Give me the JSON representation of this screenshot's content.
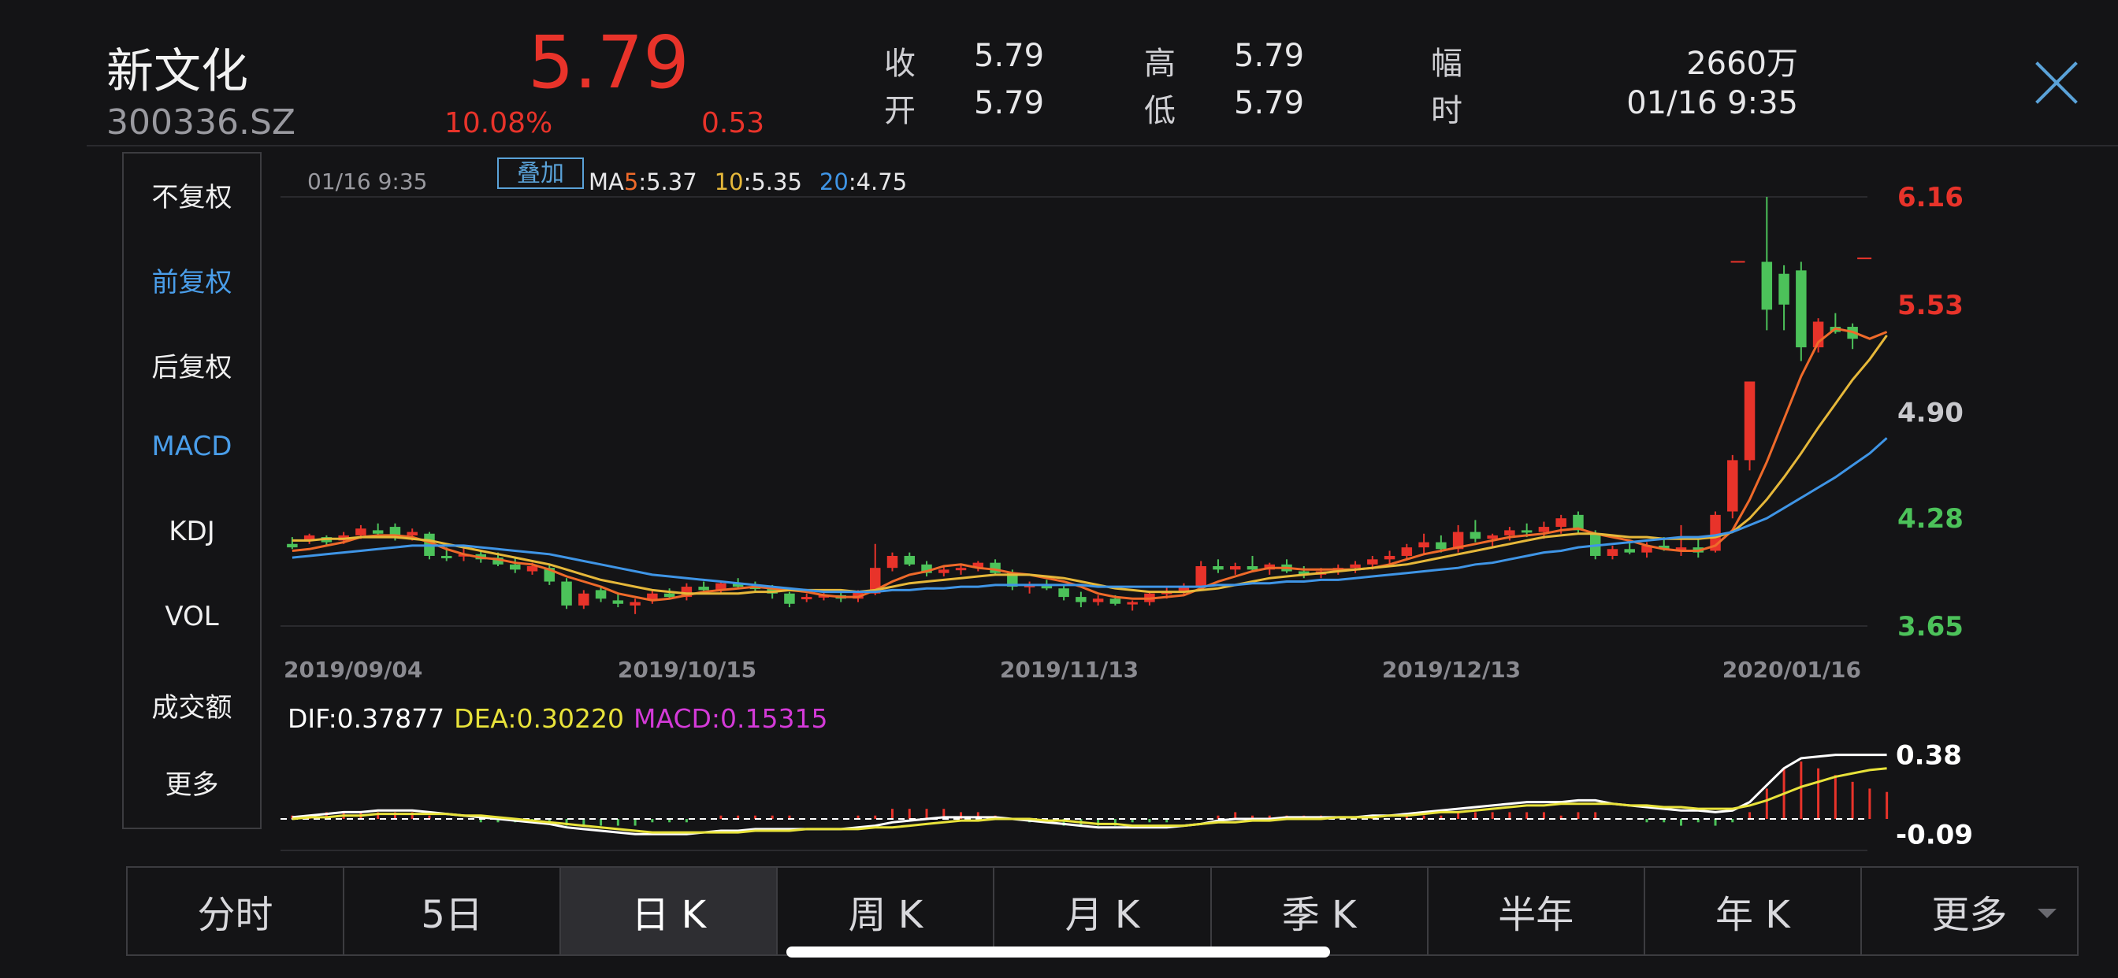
{
  "header": {
    "name": "新文化",
    "code": "300336.SZ",
    "price": "5.79",
    "change_pct": "10.08%",
    "change_amt": "0.53",
    "quote": {
      "close_label": "收",
      "close_value": "5.79",
      "open_label": "开",
      "open_value": "5.79",
      "high_label": "高",
      "high_value": "5.79",
      "low_label": "低",
      "low_value": "5.79",
      "amp_label": "幅",
      "amp_value": "2660万",
      "time_label": "时",
      "time_value": "01/16 9:35"
    }
  },
  "sidebar": {
    "items": [
      {
        "label": "不复权",
        "active": false
      },
      {
        "label": "前复权",
        "active": true
      },
      {
        "label": "后复权",
        "active": false
      },
      {
        "label": "MACD",
        "active": true
      },
      {
        "label": "KDJ",
        "active": false
      },
      {
        "label": "VOL",
        "active": false
      },
      {
        "label": "成交额",
        "active": false
      },
      {
        "label": "更多",
        "active": false
      }
    ]
  },
  "chart_info": {
    "time": "01/16 9:35",
    "overlay_label": "叠加",
    "ma_prefix": "MA",
    "ma5_label": "5",
    "ma5_value": ":5.37",
    "ma10_label": "10",
    "ma10_value": ":5.35",
    "ma20_label": "20",
    "ma20_value": ":4.75"
  },
  "indicator": {
    "dif": "DIF:0.37877",
    "dea": "DEA:0.30220",
    "macd": "MACD:0.15315"
  },
  "tabs": [
    {
      "label": "分时",
      "active": false
    },
    {
      "label": "5日",
      "active": false
    },
    {
      "label": "日 K",
      "active": true
    },
    {
      "label": "周 K",
      "active": false
    },
    {
      "label": "月 K",
      "active": false
    },
    {
      "label": "季 K",
      "active": false
    },
    {
      "label": "半年",
      "active": false
    },
    {
      "label": "年 K",
      "active": false
    },
    {
      "label": "更多",
      "active": false
    }
  ],
  "colors": {
    "up": "#e8332a",
    "down": "#4cc25a",
    "ma5": "#ef6a2a",
    "ma10": "#e6b83a",
    "ma20": "#3f95e6",
    "dif": "#ffffff",
    "dea": "#e8e23a",
    "macd": "#d43ad8",
    "accent": "#4a9eea"
  },
  "chart_data": {
    "type": "candlestick",
    "x_labels": [
      "2019/09/04",
      "2019/10/15",
      "2019/11/13",
      "2019/12/13",
      "2020/01/16"
    ],
    "y_labels": [
      "6.16",
      "5.53",
      "4.90",
      "4.28",
      "3.65"
    ],
    "ylim": [
      3.65,
      6.16
    ],
    "candles": [
      [
        4.13,
        4.17,
        4.1,
        4.11
      ],
      [
        4.15,
        4.19,
        4.13,
        4.18
      ],
      [
        4.17,
        4.18,
        4.12,
        4.14
      ],
      [
        4.15,
        4.2,
        4.13,
        4.18
      ],
      [
        4.18,
        4.24,
        4.16,
        4.22
      ],
      [
        4.21,
        4.25,
        4.17,
        4.19
      ],
      [
        4.23,
        4.25,
        4.15,
        4.17
      ],
      [
        4.18,
        4.22,
        4.15,
        4.2
      ],
      [
        4.19,
        4.2,
        4.04,
        4.06
      ],
      [
        4.06,
        4.11,
        4.03,
        4.05
      ],
      [
        4.06,
        4.11,
        4.03,
        4.07
      ],
      [
        4.07,
        4.09,
        4.02,
        4.04
      ],
      [
        4.05,
        4.08,
        4.0,
        4.01
      ],
      [
        4.01,
        4.05,
        3.96,
        3.98
      ],
      [
        3.97,
        4.02,
        3.95,
        4.0
      ],
      [
        3.99,
        4.01,
        3.89,
        3.91
      ],
      [
        3.91,
        3.93,
        3.75,
        3.77
      ],
      [
        3.77,
        3.86,
        3.75,
        3.84
      ],
      [
        3.86,
        3.88,
        3.79,
        3.81
      ],
      [
        3.8,
        3.84,
        3.76,
        3.78
      ],
      [
        3.77,
        3.81,
        3.72,
        3.79
      ],
      [
        3.8,
        3.86,
        3.78,
        3.84
      ],
      [
        3.84,
        3.87,
        3.81,
        3.82
      ],
      [
        3.82,
        3.9,
        3.8,
        3.88
      ],
      [
        3.88,
        3.91,
        3.85,
        3.86
      ],
      [
        3.86,
        3.91,
        3.84,
        3.9
      ],
      [
        3.9,
        3.93,
        3.87,
        3.88
      ],
      [
        3.88,
        3.91,
        3.85,
        3.87
      ],
      [
        3.87,
        3.89,
        3.81,
        3.84
      ],
      [
        3.84,
        3.85,
        3.76,
        3.78
      ],
      [
        3.81,
        3.84,
        3.79,
        3.82
      ],
      [
        3.82,
        3.86,
        3.8,
        3.83
      ],
      [
        3.83,
        3.86,
        3.79,
        3.81
      ],
      [
        3.81,
        3.86,
        3.79,
        3.85
      ],
      [
        3.84,
        4.13,
        3.83,
        3.99
      ],
      [
        3.99,
        4.08,
        3.97,
        4.06
      ],
      [
        4.06,
        4.08,
        4.0,
        4.01
      ],
      [
        4.01,
        4.03,
        3.94,
        3.96
      ],
      [
        3.96,
        4.0,
        3.94,
        3.98
      ],
      [
        3.98,
        4.01,
        3.95,
        3.99
      ],
      [
        3.99,
        4.03,
        3.97,
        4.02
      ],
      [
        4.02,
        4.04,
        3.95,
        3.96
      ],
      [
        3.96,
        3.98,
        3.86,
        3.88
      ],
      [
        3.88,
        3.91,
        3.84,
        3.89
      ],
      [
        3.89,
        3.92,
        3.86,
        3.87
      ],
      [
        3.87,
        3.89,
        3.8,
        3.82
      ],
      [
        3.82,
        3.85,
        3.76,
        3.79
      ],
      [
        3.79,
        3.83,
        3.77,
        3.81
      ],
      [
        3.81,
        3.83,
        3.77,
        3.78
      ],
      [
        3.78,
        3.8,
        3.74,
        3.79
      ],
      [
        3.79,
        3.85,
        3.77,
        3.84
      ],
      [
        3.84,
        3.88,
        3.81,
        3.85
      ],
      [
        3.85,
        3.9,
        3.83,
        3.88
      ],
      [
        3.88,
        4.03,
        3.86,
        4.0
      ],
      [
        4.0,
        4.04,
        3.96,
        3.98
      ],
      [
        3.98,
        4.02,
        3.95,
        4.0
      ],
      [
        4.0,
        4.06,
        3.97,
        3.98
      ],
      [
        3.98,
        4.02,
        3.95,
        4.01
      ],
      [
        4.01,
        4.04,
        3.96,
        3.97
      ],
      [
        3.97,
        4.0,
        3.93,
        3.95
      ],
      [
        3.95,
        3.99,
        3.93,
        3.97
      ],
      [
        3.97,
        4.01,
        3.95,
        3.99
      ],
      [
        3.99,
        4.03,
        3.96,
        4.01
      ],
      [
        4.01,
        4.06,
        3.98,
        4.04
      ],
      [
        4.04,
        4.09,
        4.0,
        4.06
      ],
      [
        4.06,
        4.13,
        4.04,
        4.11
      ],
      [
        4.11,
        4.19,
        4.07,
        4.14
      ],
      [
        4.14,
        4.18,
        4.08,
        4.1
      ],
      [
        4.1,
        4.24,
        4.08,
        4.2
      ],
      [
        4.2,
        4.27,
        4.14,
        4.16
      ],
      [
        4.16,
        4.19,
        4.11,
        4.18
      ],
      [
        4.18,
        4.23,
        4.15,
        4.21
      ],
      [
        4.21,
        4.25,
        4.17,
        4.2
      ],
      [
        4.2,
        4.26,
        4.16,
        4.23
      ],
      [
        4.23,
        4.3,
        4.19,
        4.28
      ],
      [
        4.3,
        4.32,
        4.19,
        4.21
      ],
      [
        4.19,
        4.21,
        4.04,
        4.06
      ],
      [
        4.06,
        4.12,
        4.04,
        4.1
      ],
      [
        4.1,
        4.15,
        4.07,
        4.08
      ],
      [
        4.08,
        4.14,
        4.05,
        4.12
      ],
      [
        4.12,
        4.17,
        4.09,
        4.1
      ],
      [
        4.1,
        4.24,
        4.06,
        4.11
      ],
      [
        4.11,
        4.16,
        4.05,
        4.08
      ],
      [
        4.09,
        4.32,
        4.08,
        4.3
      ],
      [
        4.32,
        4.65,
        4.28,
        4.62
      ],
      [
        4.62,
        5.08,
        4.56,
        5.08
      ],
      [
        5.78,
        6.16,
        5.38,
        5.5
      ],
      [
        5.71,
        5.76,
        5.38,
        5.53
      ],
      [
        5.73,
        5.78,
        5.2,
        5.28
      ],
      [
        5.28,
        5.45,
        5.25,
        5.43
      ],
      [
        5.4,
        5.48,
        5.36,
        5.37
      ],
      [
        5.4,
        5.42,
        5.27,
        5.33
      ]
    ],
    "ma": [
      {
        "name": "MA5",
        "values": [
          4.09,
          4.1,
          4.12,
          4.14,
          4.17,
          4.18,
          4.18,
          4.17,
          4.14,
          4.1,
          4.07,
          4.05,
          4.04,
          4.02,
          4.01,
          3.98,
          3.94,
          3.91,
          3.88,
          3.84,
          3.82,
          3.8,
          3.81,
          3.83,
          3.85,
          3.86,
          3.87,
          3.88,
          3.87,
          3.86,
          3.85,
          3.83,
          3.82,
          3.82,
          3.86,
          3.91,
          3.95,
          3.97,
          4.0,
          4.01,
          3.99,
          3.98,
          3.96,
          3.95,
          3.93,
          3.91,
          3.88,
          3.84,
          3.82,
          3.81,
          3.81,
          3.82,
          3.83,
          3.87,
          3.91,
          3.94,
          3.97,
          3.99,
          3.99,
          3.98,
          3.98,
          3.98,
          3.98,
          3.99,
          4.01,
          4.04,
          4.07,
          4.09,
          4.11,
          4.13,
          4.15,
          4.17,
          4.18,
          4.19,
          4.21,
          4.22,
          4.19,
          4.17,
          4.15,
          4.12,
          4.1,
          4.09,
          4.09,
          4.12,
          4.21,
          4.39,
          4.61,
          4.86,
          5.11,
          5.31,
          5.39,
          5.37,
          5.33,
          5.37
        ]
      },
      {
        "name": "MA10",
        "values": [
          4.15,
          4.15,
          4.16,
          4.16,
          4.17,
          4.17,
          4.17,
          4.16,
          4.15,
          4.13,
          4.11,
          4.09,
          4.07,
          4.05,
          4.03,
          4.01,
          3.98,
          3.95,
          3.92,
          3.9,
          3.88,
          3.86,
          3.85,
          3.84,
          3.84,
          3.84,
          3.84,
          3.85,
          3.85,
          3.86,
          3.86,
          3.86,
          3.86,
          3.85,
          3.86,
          3.88,
          3.9,
          3.91,
          3.92,
          3.93,
          3.94,
          3.95,
          3.95,
          3.95,
          3.94,
          3.93,
          3.91,
          3.89,
          3.87,
          3.86,
          3.85,
          3.85,
          3.85,
          3.86,
          3.87,
          3.89,
          3.91,
          3.93,
          3.94,
          3.95,
          3.96,
          3.97,
          3.98,
          3.99,
          4.0,
          4.01,
          4.03,
          4.05,
          4.07,
          4.09,
          4.11,
          4.13,
          4.15,
          4.17,
          4.18,
          4.19,
          4.19,
          4.18,
          4.17,
          4.17,
          4.16,
          4.16,
          4.16,
          4.17,
          4.2,
          4.28,
          4.39,
          4.52,
          4.66,
          4.81,
          4.95,
          5.09,
          5.21,
          5.35
        ]
      },
      {
        "name": "MA20",
        "values": [
          4.05,
          4.06,
          4.07,
          4.08,
          4.09,
          4.1,
          4.11,
          4.12,
          4.12,
          4.12,
          4.12,
          4.11,
          4.1,
          4.09,
          4.08,
          4.07,
          4.05,
          4.03,
          4.01,
          3.99,
          3.97,
          3.95,
          3.94,
          3.93,
          3.92,
          3.91,
          3.9,
          3.89,
          3.88,
          3.87,
          3.86,
          3.85,
          3.85,
          3.85,
          3.85,
          3.86,
          3.86,
          3.87,
          3.87,
          3.88,
          3.88,
          3.89,
          3.89,
          3.89,
          3.89,
          3.89,
          3.89,
          3.88,
          3.88,
          3.88,
          3.88,
          3.88,
          3.88,
          3.88,
          3.89,
          3.89,
          3.9,
          3.9,
          3.91,
          3.91,
          3.92,
          3.92,
          3.93,
          3.94,
          3.95,
          3.96,
          3.97,
          3.98,
          3.99,
          4.01,
          4.02,
          4.04,
          4.06,
          4.08,
          4.09,
          4.11,
          4.12,
          4.13,
          4.14,
          4.15,
          4.16,
          4.17,
          4.17,
          4.18,
          4.2,
          4.24,
          4.28,
          4.34,
          4.4,
          4.46,
          4.52,
          4.59,
          4.66,
          4.75
        ]
      }
    ],
    "macd_labels": [
      "0.38",
      "-0.09"
    ],
    "macd_ylim": [
      -0.14,
      0.56
    ],
    "dif": [
      0.01,
      0.02,
      0.03,
      0.04,
      0.04,
      0.05,
      0.05,
      0.05,
      0.04,
      0.03,
      0.02,
      0.01,
      0.0,
      -0.01,
      -0.02,
      -0.03,
      -0.05,
      -0.06,
      -0.07,
      -0.08,
      -0.09,
      -0.09,
      -0.09,
      -0.09,
      -0.08,
      -0.07,
      -0.07,
      -0.06,
      -0.06,
      -0.06,
      -0.06,
      -0.06,
      -0.06,
      -0.05,
      -0.04,
      -0.02,
      -0.01,
      0.0,
      0.01,
      0.01,
      0.01,
      0.01,
      0.0,
      -0.01,
      -0.02,
      -0.03,
      -0.04,
      -0.05,
      -0.05,
      -0.05,
      -0.05,
      -0.05,
      -0.04,
      -0.03,
      -0.01,
      0.0,
      0.0,
      0.0,
      0.01,
      0.01,
      0.01,
      0.01,
      0.01,
      0.02,
      0.02,
      0.03,
      0.04,
      0.05,
      0.06,
      0.07,
      0.08,
      0.09,
      0.1,
      0.1,
      0.1,
      0.11,
      0.11,
      0.09,
      0.08,
      0.07,
      0.06,
      0.05,
      0.05,
      0.04,
      0.05,
      0.1,
      0.2,
      0.3,
      0.36,
      0.37,
      0.38,
      0.38,
      0.38,
      0.38
    ],
    "dea": [
      0.0,
      0.01,
      0.01,
      0.02,
      0.02,
      0.03,
      0.03,
      0.03,
      0.03,
      0.03,
      0.02,
      0.02,
      0.01,
      0.0,
      -0.01,
      -0.02,
      -0.03,
      -0.04,
      -0.05,
      -0.06,
      -0.07,
      -0.08,
      -0.08,
      -0.08,
      -0.08,
      -0.08,
      -0.08,
      -0.07,
      -0.07,
      -0.07,
      -0.06,
      -0.06,
      -0.06,
      -0.06,
      -0.05,
      -0.05,
      -0.04,
      -0.03,
      -0.02,
      -0.01,
      -0.01,
      0.0,
      0.0,
      0.0,
      -0.01,
      -0.01,
      -0.02,
      -0.03,
      -0.03,
      -0.04,
      -0.04,
      -0.04,
      -0.04,
      -0.03,
      -0.02,
      -0.02,
      -0.01,
      -0.01,
      0.0,
      0.0,
      0.0,
      0.01,
      0.01,
      0.01,
      0.02,
      0.02,
      0.03,
      0.04,
      0.04,
      0.05,
      0.06,
      0.07,
      0.08,
      0.08,
      0.09,
      0.09,
      0.09,
      0.09,
      0.08,
      0.08,
      0.07,
      0.07,
      0.06,
      0.06,
      0.06,
      0.08,
      0.11,
      0.15,
      0.19,
      0.22,
      0.25,
      0.27,
      0.29,
      0.3
    ]
  }
}
